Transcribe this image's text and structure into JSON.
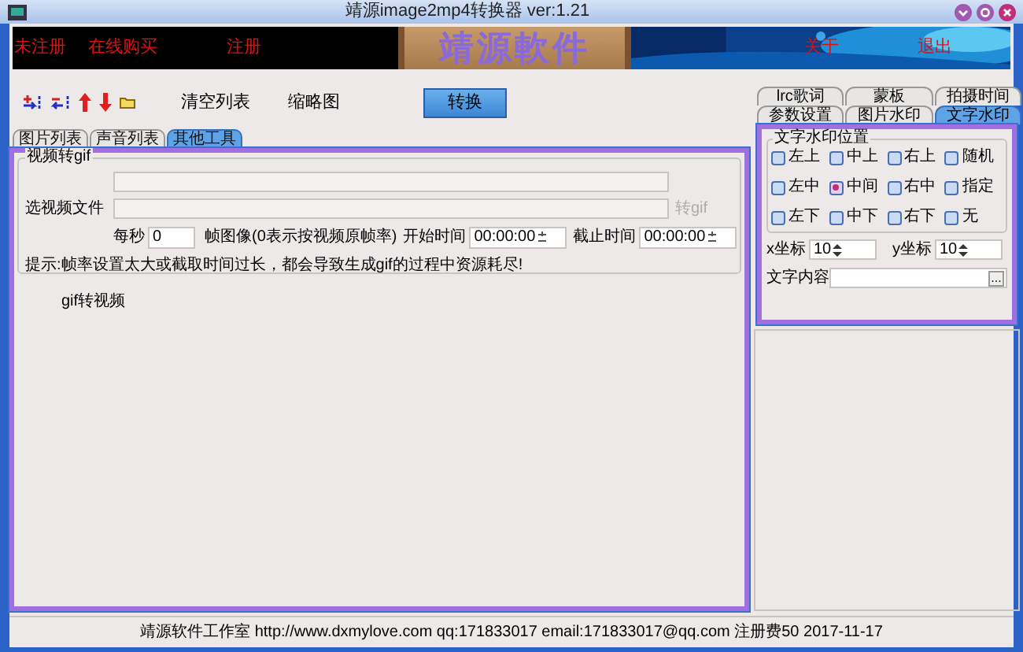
{
  "window": {
    "title": "靖源image2mp4转换器 ver:1.21"
  },
  "banner": {
    "left_links": [
      "未注册",
      "在线购买",
      "注册"
    ],
    "logo": "靖源軟件",
    "right_links": [
      "关于",
      "退出"
    ]
  },
  "toolbar": {
    "buttons": [
      "清空列表",
      "缩略图"
    ],
    "convert": "转换"
  },
  "left_tabs": [
    {
      "label": "图片列表",
      "selected": false
    },
    {
      "label": "声音列表",
      "selected": false
    },
    {
      "label": "其他工具",
      "selected": true
    }
  ],
  "gif_group": {
    "title": "视频转gif",
    "file_label": "选视频文件",
    "convert_button": {
      "label": "转gif",
      "disabled": true
    },
    "fps_label": "每秒",
    "fps_value": "0",
    "fps_hint": "帧图像(0表示按视频原帧率)",
    "start_label": "开始时间",
    "start_value": "00:00:00",
    "end_label": "截止时间",
    "end_value": "00:00:00",
    "tip": "提示:帧率设置太大或截取时间过长，都会导致生成gif的过程中资源耗尽!"
  },
  "gif_to_video": "gif转视频",
  "right_tab_rows": [
    {
      "tabs": [
        {
          "label": "lrc歌词",
          "selected": false
        },
        {
          "label": "蒙板",
          "selected": false
        },
        {
          "label": "拍摄时间",
          "selected": false
        }
      ]
    },
    {
      "tabs": [
        {
          "label": "参数设置",
          "selected": false
        },
        {
          "label": "图片水印",
          "selected": false
        },
        {
          "label": "文字水印",
          "selected": true
        }
      ]
    }
  ],
  "watermark": {
    "group_title": "文字水印位置",
    "positions": [
      {
        "label": "左上",
        "selected": false
      },
      {
        "label": "中上",
        "selected": false
      },
      {
        "label": "右上",
        "selected": false
      },
      {
        "label": "随机",
        "selected": false
      },
      {
        "label": "左中",
        "selected": false
      },
      {
        "label": "中间",
        "selected": true
      },
      {
        "label": "右中",
        "selected": false
      },
      {
        "label": "指定",
        "selected": false
      },
      {
        "label": "左下",
        "selected": false
      },
      {
        "label": "中下",
        "selected": false
      },
      {
        "label": "右下",
        "selected": false
      },
      {
        "label": "无",
        "selected": false
      }
    ],
    "x_label": "x坐标",
    "x_value": "10",
    "y_label": "y坐标",
    "y_value": "10",
    "text_label": "文字内容",
    "browse": "..."
  },
  "status_bar": "靖源软件工作室 http://www.dxmylove.com qq:171833017 email:171833017@qq.com 注册费50 2017-11-17"
}
